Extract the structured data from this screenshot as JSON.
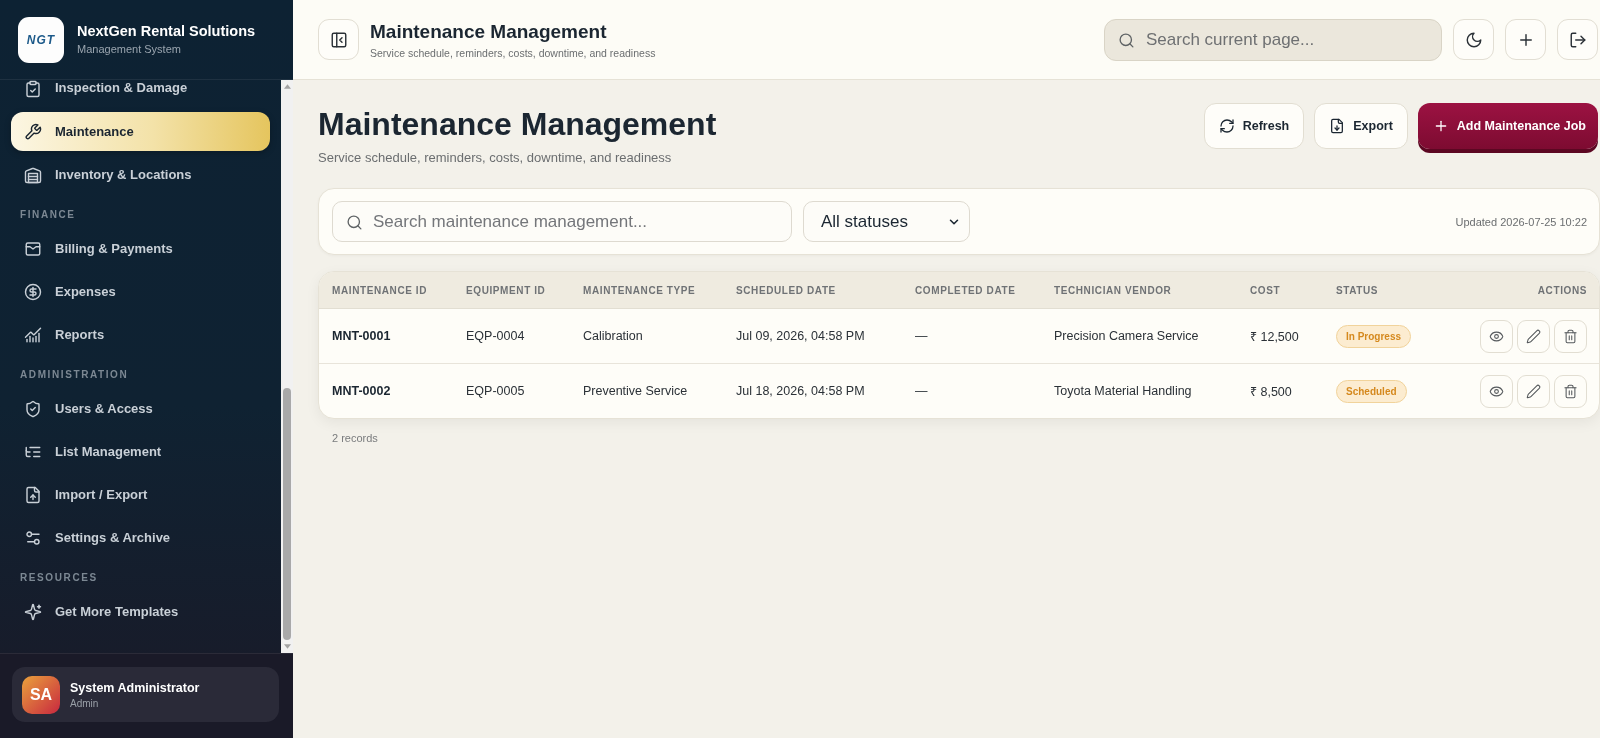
{
  "sidebar": {
    "brand": {
      "logo_text": "NGT",
      "name": "NextGen Rental Solutions",
      "subtitle": "Management System"
    },
    "sections": [
      {
        "items": [
          {
            "label": "Inspection & Damage",
            "selected": false
          },
          {
            "label": "Maintenance",
            "selected": true
          },
          {
            "label": "Inventory & Locations",
            "selected": false
          }
        ]
      },
      {
        "heading": "FINANCE",
        "items": [
          {
            "label": "Billing & Payments",
            "selected": false
          },
          {
            "label": "Expenses",
            "selected": false
          },
          {
            "label": "Reports",
            "selected": false
          }
        ]
      },
      {
        "heading": "ADMINISTRATION",
        "items": [
          {
            "label": "Users & Access",
            "selected": false
          },
          {
            "label": "List Management",
            "selected": false
          },
          {
            "label": "Import / Export",
            "selected": false
          },
          {
            "label": "Settings & Archive",
            "selected": false
          }
        ]
      },
      {
        "heading": "RESOURCES",
        "items": [
          {
            "label": "Get More Templates",
            "selected": false
          }
        ]
      }
    ],
    "user": {
      "initials": "SA",
      "name": "System Administrator",
      "role": "Admin"
    }
  },
  "topbar": {
    "title": "Maintenance Management",
    "subtitle": "Service schedule, reminders, costs, downtime, and readiness",
    "search": {
      "placeholder": "Search current page..."
    }
  },
  "page_header": {
    "title": "Maintenance Management",
    "subtitle": "Service schedule, reminders, costs, downtime, and readiness",
    "actions": [
      {
        "label": "Refresh",
        "kind": "secondary"
      },
      {
        "label": "Export",
        "kind": "secondary"
      },
      {
        "label": "Add Maintenance Job",
        "kind": "primary"
      }
    ]
  },
  "filters": {
    "search": {
      "placeholder": "Search maintenance management..."
    },
    "status_filter": {
      "value": "All statuses"
    },
    "updated": "Updated 2026-07-25 10:22"
  },
  "table": {
    "columns": [
      "MAINTENANCE ID",
      "EQUIPMENT ID",
      "MAINTENANCE TYPE",
      "SCHEDULED DATE",
      "COMPLETED DATE",
      "TECHNICIAN VENDOR",
      "COST",
      "STATUS",
      "ACTIONS"
    ],
    "rows": [
      {
        "maintenance_id": "MNT-0001",
        "equipment_id": "EQP-0004",
        "maintenance_type": "Calibration",
        "scheduled_date": "Jul 09, 2026, 04:58 PM",
        "completed_date": "—",
        "technician_vendor": "Precision Camera Service",
        "cost": "₹ 12,500",
        "status": "In Progress"
      },
      {
        "maintenance_id": "MNT-0002",
        "equipment_id": "EQP-0005",
        "maintenance_type": "Preventive Service",
        "scheduled_date": "Jul 18, 2026, 04:58 PM",
        "completed_date": "—",
        "technician_vendor": "Toyota Material Handling",
        "cost": "₹ 8,500",
        "status": "Scheduled"
      }
    ]
  },
  "footer": {
    "record_count": "2 records"
  }
}
